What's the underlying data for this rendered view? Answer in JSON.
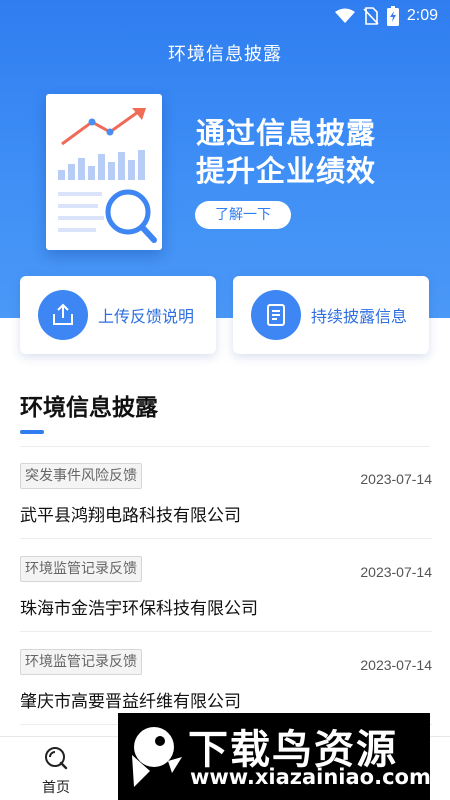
{
  "status_bar": {
    "time": "2:09",
    "icons": [
      "wifi-icon",
      "no-sim-icon",
      "battery-charging-icon"
    ]
  },
  "header": {
    "title": "环境信息披露"
  },
  "banner": {
    "slogan_line1": "通过信息披露",
    "slogan_line2": "提升企业绩效",
    "button_label": "了解一下",
    "illustration": "report-chart-magnifier-icon"
  },
  "actions": [
    {
      "label": "上传反馈说明",
      "icon": "upload-icon"
    },
    {
      "label": "持续披露信息",
      "icon": "document-list-icon"
    }
  ],
  "section": {
    "title": "环境信息披露"
  },
  "news": [
    {
      "tag": "突发事件风险反馈",
      "date": "2023-07-14",
      "company": "武平县鸿翔电路科技有限公司"
    },
    {
      "tag": "环境监管记录反馈",
      "date": "2023-07-14",
      "company": "珠海市金浩宇环保科技有限公司"
    },
    {
      "tag": "环境监管记录反馈",
      "date": "2023-07-14",
      "company": "肇庆市高要晋益纤维有限公司"
    }
  ],
  "tabbar": {
    "home_label": "首页",
    "home_icon": "search-circle-icon"
  },
  "watermark": {
    "title": "下载鸟资源",
    "url": "www.xiazainiao.com"
  },
  "colors": {
    "primary": "#2f7df0",
    "action_text": "#2f6fe0",
    "chart_red": "#ef6b56"
  }
}
